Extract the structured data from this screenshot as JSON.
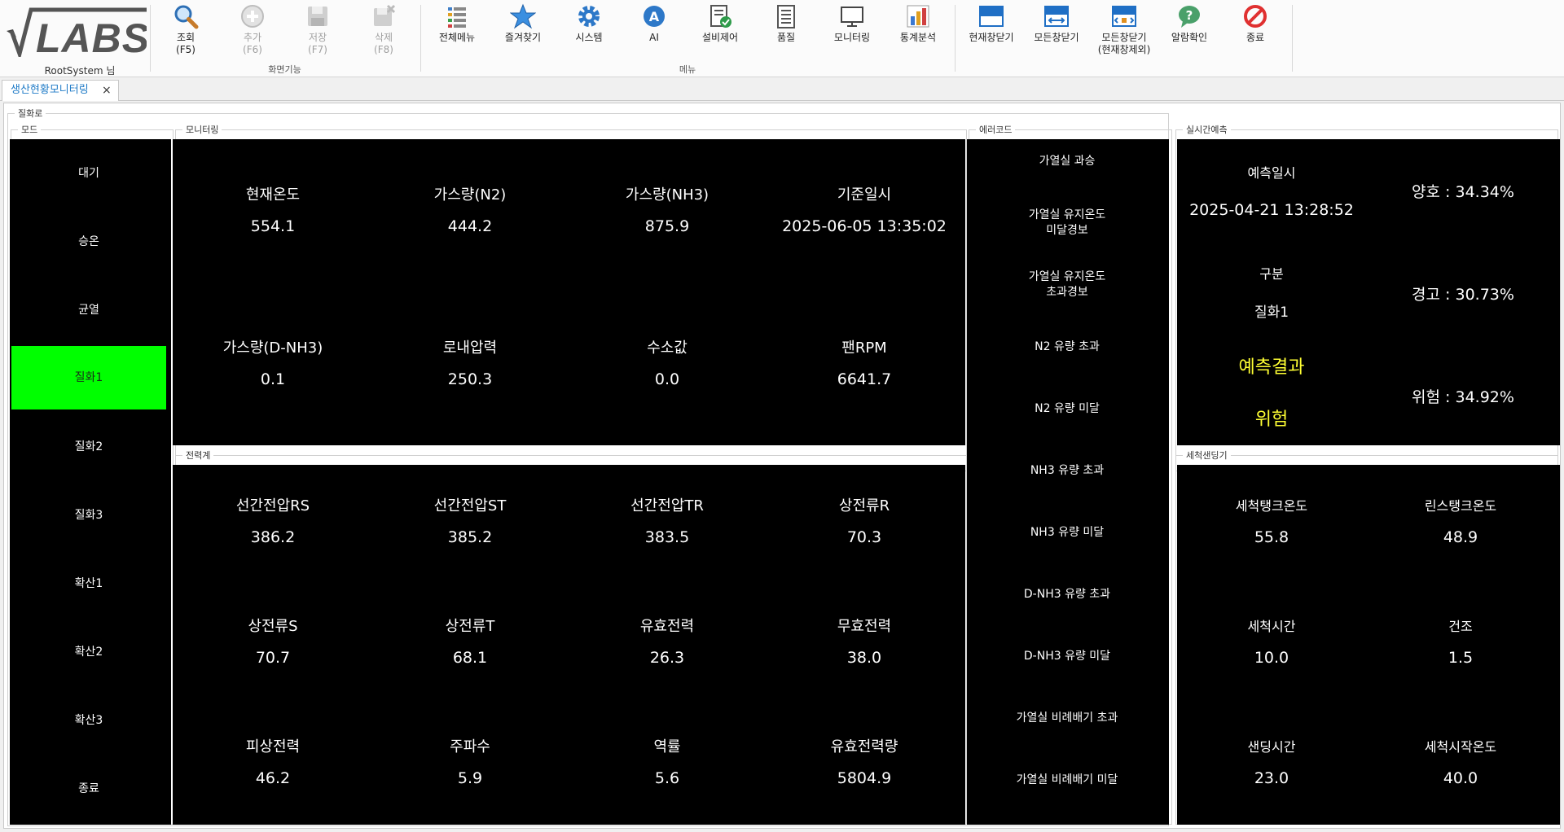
{
  "user": {
    "label": "RootSystem 님"
  },
  "toolbar": {
    "group_screen": "화면기능",
    "group_menu": "메뉴",
    "buttons": {
      "search": {
        "label": "조회",
        "key": "(F5)"
      },
      "add": {
        "label": "추가",
        "key": "(F6)"
      },
      "save": {
        "label": "저장",
        "key": "(F7)"
      },
      "delete": {
        "label": "삭제",
        "key": "(F8)"
      },
      "allmenu": {
        "label": "전체메뉴"
      },
      "favorites": {
        "label": "즐겨찾기"
      },
      "system": {
        "label": "시스템"
      },
      "ai": {
        "label": "AI"
      },
      "equipment": {
        "label": "설비제어"
      },
      "quality": {
        "label": "품질"
      },
      "monitoring": {
        "label": "모니터링"
      },
      "stats": {
        "label": "통계분석"
      },
      "close_current": {
        "label": "현재창닫기"
      },
      "close_all": {
        "label": "모든창닫기"
      },
      "close_others": {
        "label": "모든창닫기",
        "sub": "(현재창제외)"
      },
      "alarm": {
        "label": "알람확인"
      },
      "exit": {
        "label": "종료"
      }
    }
  },
  "tab": {
    "label": "생산현황모니터링",
    "close": "×"
  },
  "content": {
    "group_title": "질화로",
    "mode": {
      "caption": "모드",
      "items": [
        "대기",
        "승온",
        "균열",
        "질화1",
        "질화2",
        "질화3",
        "확산1",
        "확산2",
        "확산3",
        "종료"
      ],
      "active_index": 3
    },
    "monitoring": {
      "caption": "모니터링",
      "items": [
        {
          "label": "현재온도",
          "value": "554.1"
        },
        {
          "label": "가스량(N2)",
          "value": "444.2"
        },
        {
          "label": "가스량(NH3)",
          "value": "875.9"
        },
        {
          "label": "기준일시",
          "value": "2025-06-05 13:35:02"
        },
        {
          "label": "가스량(D-NH3)",
          "value": "0.1"
        },
        {
          "label": "로내압력",
          "value": "250.3"
        },
        {
          "label": "수소값",
          "value": "0.0"
        },
        {
          "label": "팬RPM",
          "value": "6641.7"
        }
      ]
    },
    "power": {
      "caption": "전력계",
      "items": [
        {
          "label": "선간전압RS",
          "value": "386.2"
        },
        {
          "label": "선간전압ST",
          "value": "385.2"
        },
        {
          "label": "선간전압TR",
          "value": "383.5"
        },
        {
          "label": "상전류R",
          "value": "70.3"
        },
        {
          "label": "상전류S",
          "value": "70.7"
        },
        {
          "label": "상전류T",
          "value": "68.1"
        },
        {
          "label": "유효전력",
          "value": "26.3"
        },
        {
          "label": "무효전력",
          "value": "38.0"
        },
        {
          "label": "피상전력",
          "value": "46.2"
        },
        {
          "label": "주파수",
          "value": "5.9"
        },
        {
          "label": "역률",
          "value": "5.6"
        },
        {
          "label": "유효전력량",
          "value": "5804.9"
        }
      ]
    },
    "errors": {
      "caption": "에러코드",
      "items": [
        "가열실 과승",
        "가열실 유지온도\n미달경보",
        "가열실 유지온도\n초과경보",
        "N2 유량 초과",
        "N2 유량 미달",
        "NH3 유량 초과",
        "NH3 유량 미달",
        "D-NH3 유량 초과",
        "D-NH3 유량 미달",
        "가열실 비례배기 초과",
        "가열실 비례배기 미달"
      ]
    },
    "prediction": {
      "caption": "실시간예측",
      "date_label": "예측일시",
      "date_value": "2025-04-21 13:28:52",
      "type_label": "구분",
      "type_value": "질화1",
      "result_label": "예측결과",
      "result_value": "위험",
      "good": "양호 : 34.34%",
      "warn": "경고 : 30.73%",
      "danger": "위험 : 34.92%"
    },
    "washer": {
      "caption": "세척샌딩기",
      "items": [
        {
          "label": "세척탱크온도",
          "value": "55.8"
        },
        {
          "label": "린스탱크온도",
          "value": "48.9"
        },
        {
          "label": "세척시간",
          "value": "10.0"
        },
        {
          "label": "건조",
          "value": "1.5"
        },
        {
          "label": "샌딩시간",
          "value": "23.0"
        },
        {
          "label": "세척시작온도",
          "value": "40.0"
        }
      ]
    }
  }
}
